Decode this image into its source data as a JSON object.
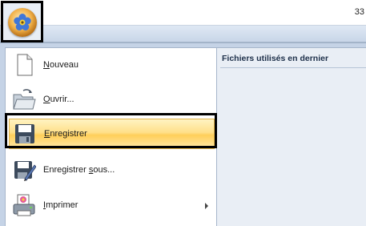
{
  "window": {
    "title_fragment": "33"
  },
  "menu": {
    "items": [
      {
        "label": "Nouveau",
        "mnemonic": "N",
        "rest": "ouveau",
        "icon": "new-document-icon"
      },
      {
        "label": "Ouvrir...",
        "mnemonic": "O",
        "rest": "uvrir...",
        "icon": "open-folder-icon"
      },
      {
        "label": "Enregistrer",
        "mnemonic": "E",
        "rest": "nregistrer",
        "icon": "save-disk-icon",
        "highlighted": true
      },
      {
        "label": "Enregistrer sous...",
        "pre": "Enregistrer ",
        "mnemonic": "s",
        "rest": "ous...",
        "icon": "save-as-icon"
      },
      {
        "label": "Imprimer",
        "mnemonic": "I",
        "rest": "mprimer",
        "icon": "printer-icon",
        "has_submenu": true
      }
    ],
    "recent_title": "Fichiers utilisés en dernier"
  },
  "colors": {
    "highlight": "#ffd36a",
    "pane_bg": "#e9eef5",
    "menu_bg": "#c5d3e6"
  }
}
